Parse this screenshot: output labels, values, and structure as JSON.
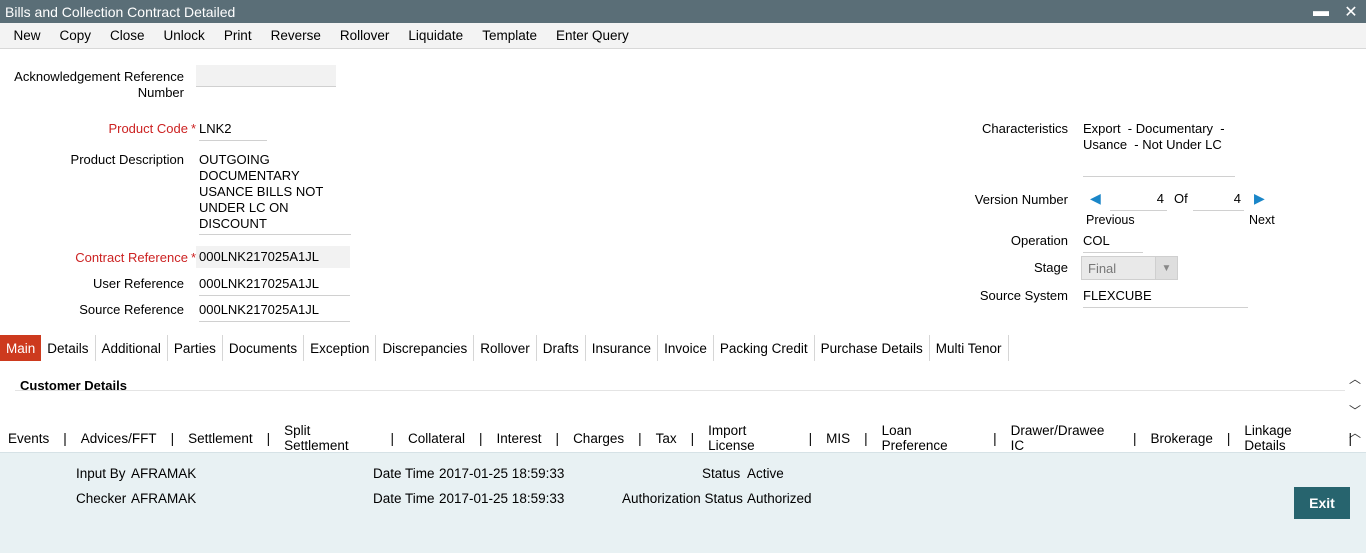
{
  "window": {
    "title": "Bills and Collection Contract Detailed",
    "minimize_glyph": "▬",
    "close_glyph": "✕"
  },
  "menu": [
    "New",
    "Copy",
    "Close",
    "Unlock",
    "Print",
    "Reverse",
    "Rollover",
    "Liquidate",
    "Template",
    "Enter Query"
  ],
  "form": {
    "ack_ref_label_1": "Acknowledgement Reference",
    "ack_ref_label_2": "Number",
    "ack_ref_value": "",
    "product_code_label": "Product Code",
    "product_code_value": "LNK2",
    "product_desc_label": "Product Description",
    "product_desc_lines": [
      "OUTGOING",
      "DOCUMENTARY",
      "USANCE BILLS NOT",
      "UNDER LC ON",
      "DISCOUNT"
    ],
    "contract_ref_label": "Contract Reference",
    "contract_ref_value": "000LNK217025A1JL",
    "user_ref_label": "User Reference",
    "user_ref_value": "000LNK217025A1JL",
    "source_ref_label": "Source Reference",
    "source_ref_value": "000LNK217025A1JL",
    "required_marker": "*",
    "characteristics_label": "Characteristics",
    "characteristics_line1": "Export  - Documentary  -",
    "characteristics_line2": "Usance  - Not Under LC",
    "version_label": "Version Number",
    "version_current": "4",
    "version_of": "Of",
    "version_total": "4",
    "previous_label": "Previous",
    "next_label": "Next",
    "operation_label": "Operation",
    "operation_value": "COL",
    "stage_label": "Stage",
    "stage_value": "Final",
    "source_system_label": "Source System",
    "source_system_value": "FLEXCUBE"
  },
  "tabs": [
    "Main",
    "Details",
    "Additional",
    "Parties",
    "Documents",
    "Exception",
    "Discrepancies",
    "Rollover",
    "Drafts",
    "Insurance",
    "Invoice",
    "Packing Credit",
    "Purchase Details",
    "Multi Tenor"
  ],
  "active_tab": "Main",
  "section": {
    "title": "Customer Details"
  },
  "sublinks": [
    "Events",
    "Advices/FFT",
    "Settlement",
    "Split Settlement",
    "Collateral",
    "Interest",
    "Charges",
    "Tax",
    "Import License",
    "MIS",
    "Loan Preference",
    "Drawer/Drawee IC",
    "Brokerage",
    "Linkage Details"
  ],
  "footer": {
    "input_by_label": "Input By",
    "input_by_value": "AFRAMAK",
    "checker_label": "Checker",
    "checker_value": "AFRAMAK",
    "datetime_label": "Date Time",
    "datetime_input": "2017-01-25 18:59:33",
    "datetime_checker": "2017-01-25 18:59:33",
    "status_label": "Status",
    "status_value": "Active",
    "auth_status_label": "Authorization Status",
    "auth_status_value": "Authorized",
    "exit_label": "Exit"
  },
  "colors": {
    "title_bar": "#5a6e77",
    "active_tab": "#cd3a1e",
    "required": "#cc2222",
    "footer_bg": "#e8f1f3",
    "exit_button": "#27646e",
    "nav_arrow": "#1a86c8"
  }
}
